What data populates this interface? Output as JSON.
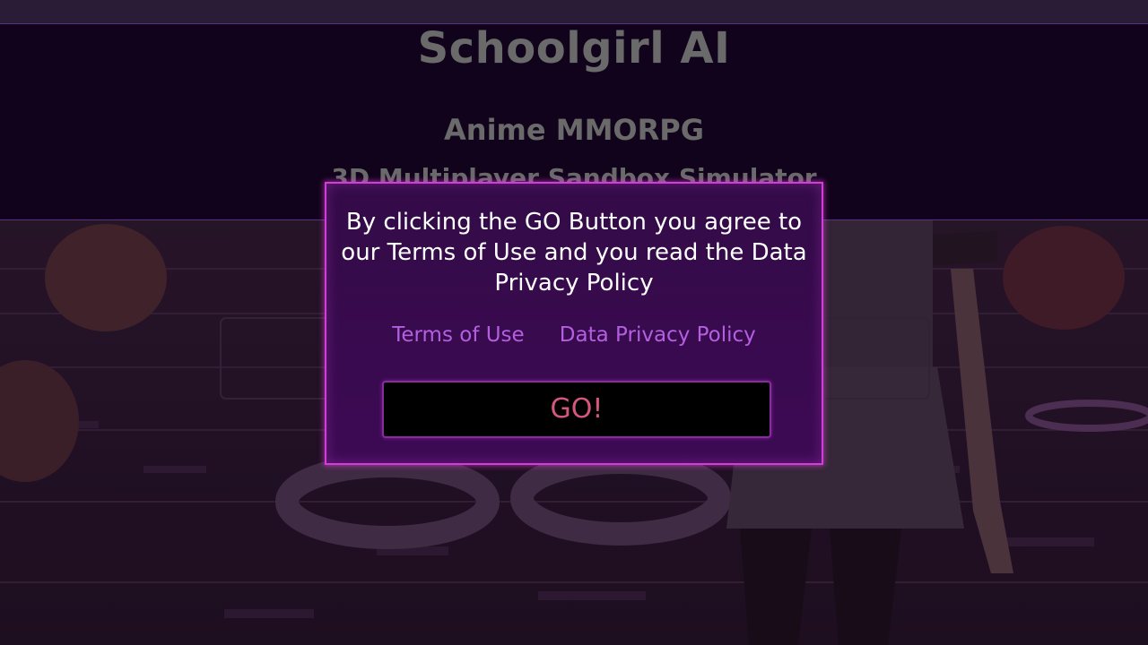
{
  "banner": {
    "title": "Schoolgirl AI",
    "subtitle": "Anime MMORPG",
    "tagline": "3D Multiplayer Sandbox Simulator"
  },
  "dialog": {
    "message": "By clicking the GO Button you agree to our Terms of Use and you read the Data Privacy Policy",
    "terms_link": "Terms of Use",
    "privacy_link": "Data Privacy Policy",
    "go_label": "GO!"
  },
  "colors": {
    "dialog_border": "#d43cd6",
    "dialog_bg": "#3a0a52",
    "link": "#b45fe0",
    "go_text": "#d4587e"
  }
}
